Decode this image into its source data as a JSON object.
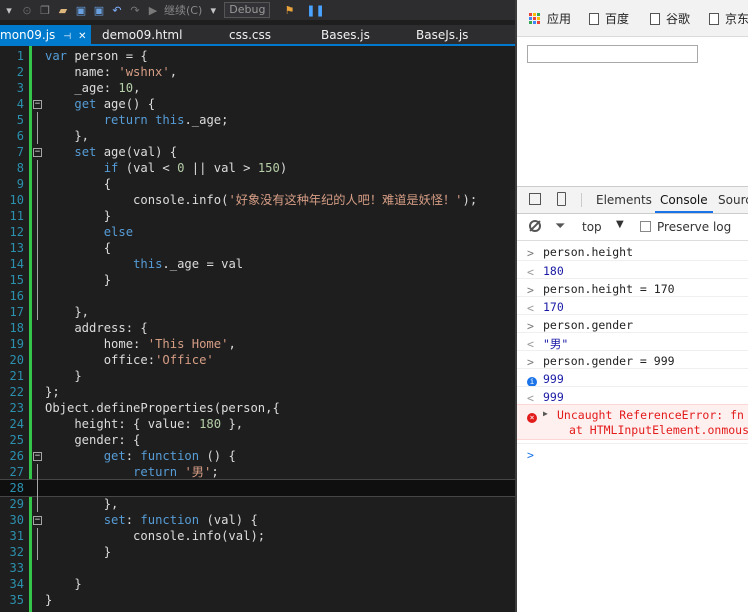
{
  "toolbar": {
    "start_label": "继续(C)",
    "config_value": "Debug"
  },
  "tabs": [
    {
      "label": "mon09.js",
      "active": true
    },
    {
      "label": "demo09.html"
    },
    {
      "label": "css.css"
    },
    {
      "label": "Bases.js"
    },
    {
      "label": "BaseJs.js"
    }
  ],
  "editor": {
    "current_line": 28,
    "lines": [
      {
        "n": "1",
        "t": "var person = {"
      },
      {
        "n": "2",
        "t": "    name: 'wshnx',"
      },
      {
        "n": "3",
        "t": "    _age: 10,"
      },
      {
        "n": "4",
        "t": "    get age() {"
      },
      {
        "n": "5",
        "t": "        return this._age;"
      },
      {
        "n": "6",
        "t": "    },"
      },
      {
        "n": "7",
        "t": "    set age(val) {"
      },
      {
        "n": "8",
        "t": "        if (val < 0 || val > 150)"
      },
      {
        "n": "9",
        "t": "        {"
      },
      {
        "n": "10",
        "t": "            console.info('好象没有这种年纪的人吧！难道是妖怪！');"
      },
      {
        "n": "11",
        "t": "        }"
      },
      {
        "n": "12",
        "t": "        else"
      },
      {
        "n": "13",
        "t": "        {"
      },
      {
        "n": "14",
        "t": "            this._age = val"
      },
      {
        "n": "15",
        "t": "        }"
      },
      {
        "n": "16",
        "t": ""
      },
      {
        "n": "17",
        "t": "    },"
      },
      {
        "n": "18",
        "t": "    address: {"
      },
      {
        "n": "19",
        "t": "        home: 'This Home',"
      },
      {
        "n": "20",
        "t": "        office:'Office'"
      },
      {
        "n": "21",
        "t": "    }"
      },
      {
        "n": "22",
        "t": "};"
      },
      {
        "n": "23",
        "t": "Object.defineProperties(person,{"
      },
      {
        "n": "24",
        "t": "    height: { value: 180 },"
      },
      {
        "n": "25",
        "t": "    gender: {"
      },
      {
        "n": "26",
        "t": "        get: function () {"
      },
      {
        "n": "27",
        "t": "            return '男';"
      },
      {
        "n": "28",
        "t": ""
      },
      {
        "n": "29",
        "t": "        },"
      },
      {
        "n": "30",
        "t": "        set: function (val) {"
      },
      {
        "n": "31",
        "t": "            console.info(val);"
      },
      {
        "n": "32",
        "t": "        }"
      },
      {
        "n": "33",
        "t": ""
      },
      {
        "n": "34",
        "t": "    }"
      },
      {
        "n": "35",
        "t": "}"
      }
    ]
  },
  "chrome": {
    "bookmarks": [
      {
        "label": "应用",
        "icon": "apps-grid-icon"
      },
      {
        "label": "百度",
        "icon": "page-icon"
      },
      {
        "label": "谷歌",
        "icon": "page-icon"
      },
      {
        "label": "京东",
        "icon": "page-icon"
      }
    ],
    "devtools": {
      "tabs": [
        "Elements",
        "Console",
        "Sources"
      ],
      "active_tab": "Console",
      "context": "top",
      "preserve_log_label": "Preserve log",
      "console": [
        {
          "kind": "in",
          "text": "person.height"
        },
        {
          "kind": "out",
          "text": "180"
        },
        {
          "kind": "in",
          "text": "person.height = 170"
        },
        {
          "kind": "out",
          "text": "170"
        },
        {
          "kind": "in",
          "text": "person.gender"
        },
        {
          "kind": "out",
          "text": "\"男\""
        },
        {
          "kind": "in",
          "text": "person.gender = 999"
        },
        {
          "kind": "info",
          "text": "999"
        },
        {
          "kind": "out",
          "text": "999"
        },
        {
          "kind": "error",
          "text": "Uncaught ReferenceError: fn is not defined",
          "text2": "at HTMLInputElement.onmouseover"
        }
      ]
    }
  }
}
